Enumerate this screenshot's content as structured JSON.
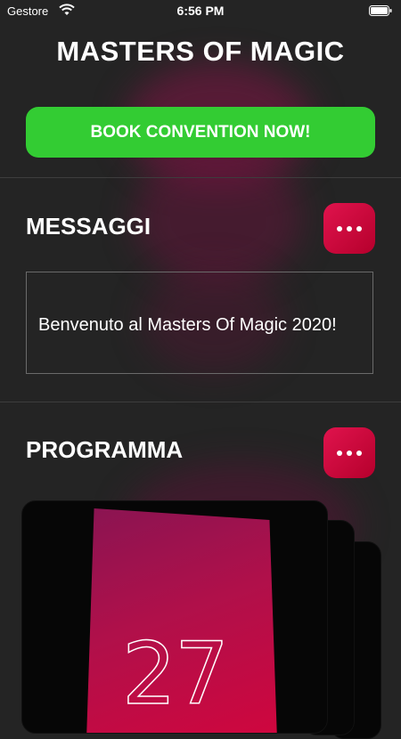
{
  "status": {
    "carrier": "Gestore",
    "time": "6:56 PM"
  },
  "title": "MASTERS OF MAGIC",
  "book_button": "BOOK CONVENTION NOW!",
  "messages": {
    "title": "MESSAGGI",
    "text": "Benvenuto al Masters Of Magic 2020!"
  },
  "program": {
    "title": "PROGRAMMA",
    "card_day": "27"
  },
  "colors": {
    "accent_green": "#33cc33",
    "accent_red": "#d8103f",
    "background": "#242424"
  },
  "icons": [
    "wifi-icon",
    "battery-icon",
    "more-icon"
  ]
}
